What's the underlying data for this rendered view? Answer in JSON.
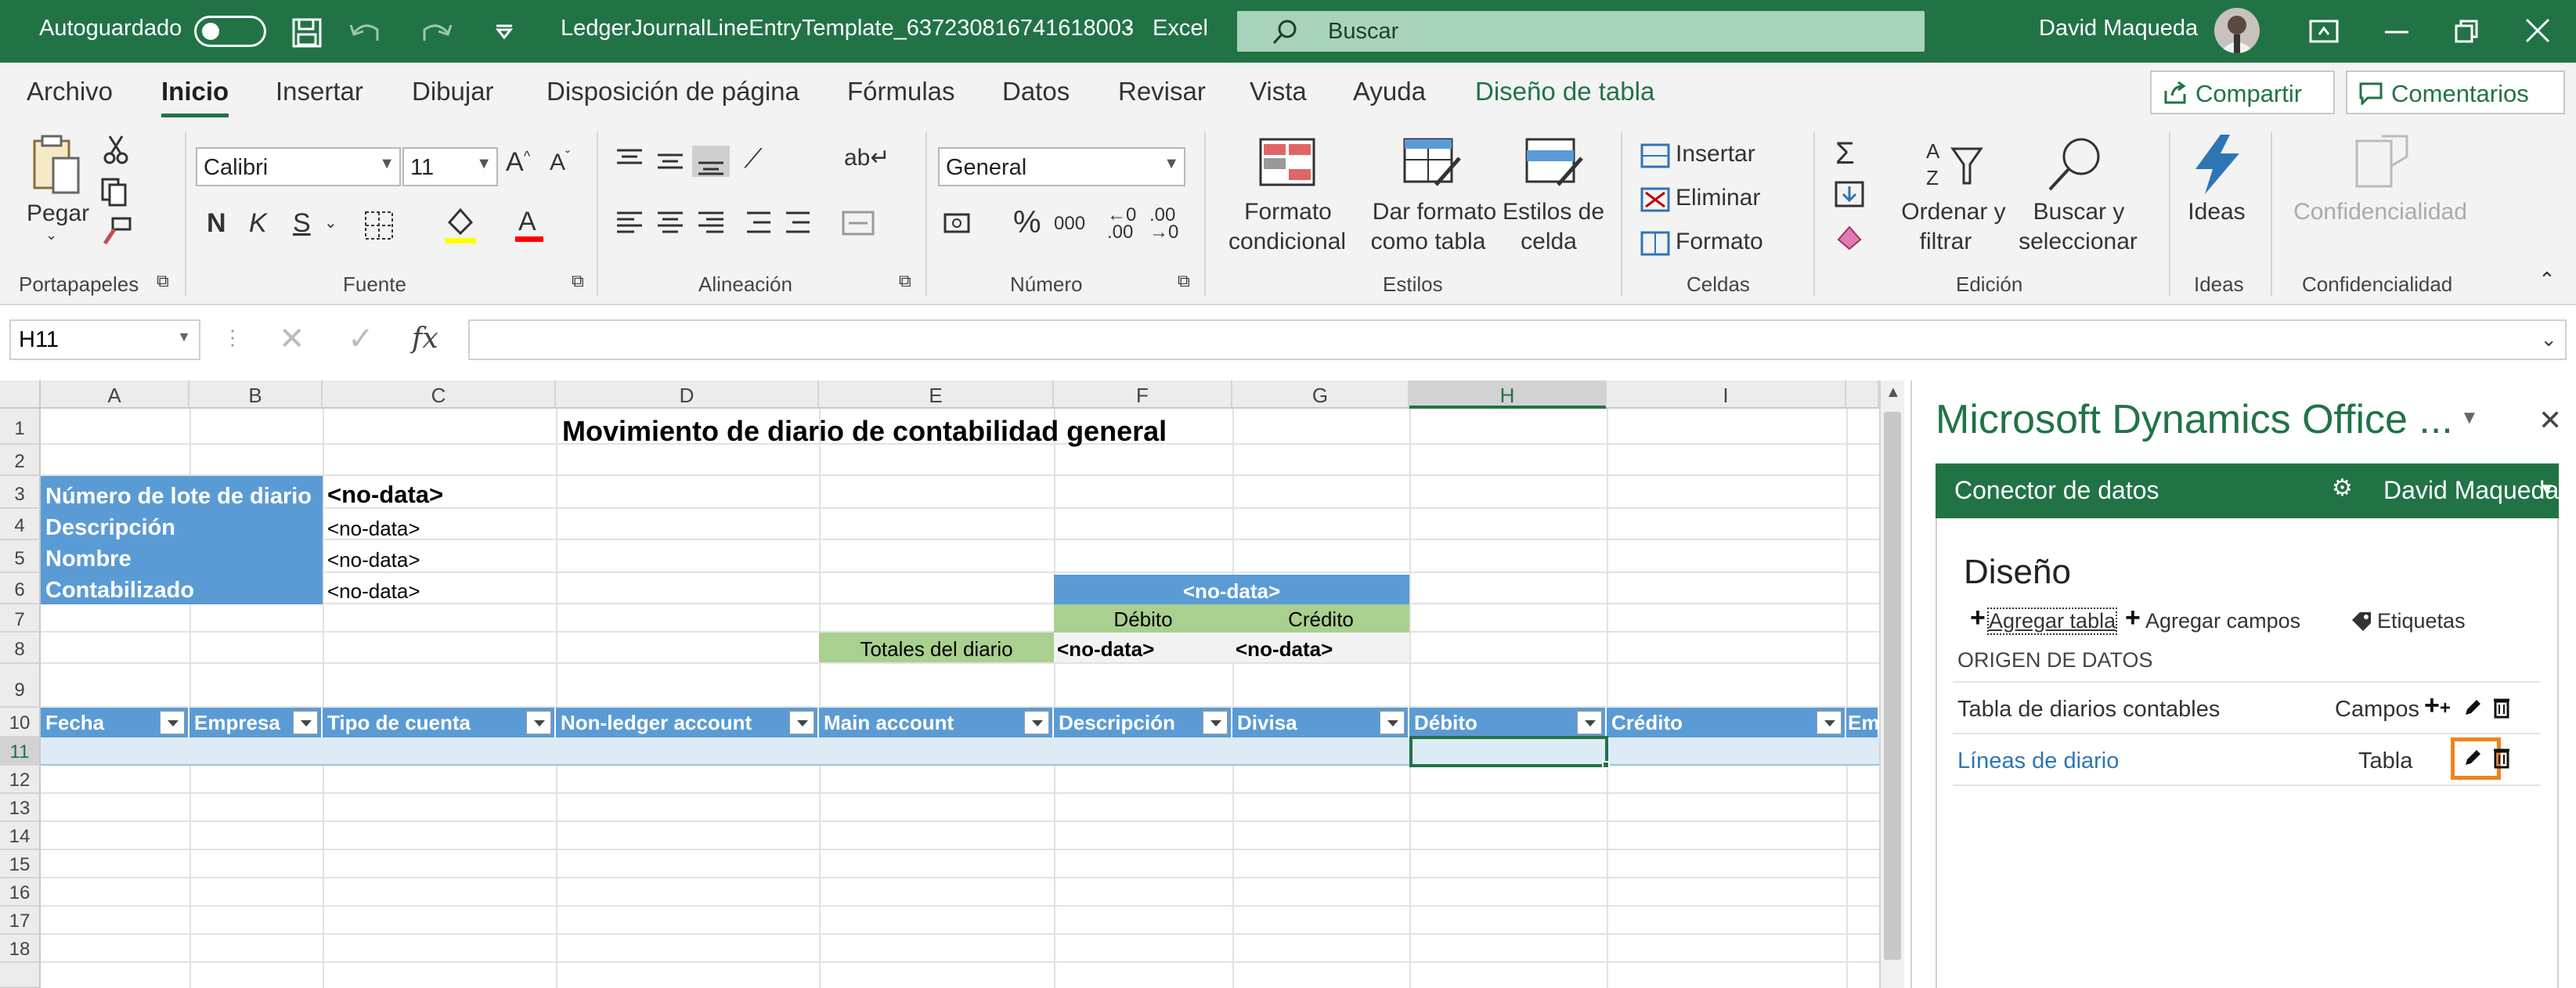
{
  "titlebar": {
    "autosave_label": "Autoguardado",
    "filename": "LedgerJournalLineEntryTemplate_637230816741618003",
    "separator": "-",
    "app_name": "Excel",
    "search_placeholder": "Buscar",
    "user_name": "David Maqueda"
  },
  "tabs": [
    "Archivo",
    "Inicio",
    "Insertar",
    "Dibujar",
    "Disposición de página",
    "Fórmulas",
    "Datos",
    "Revisar",
    "Vista",
    "Ayuda",
    "Diseño de tabla"
  ],
  "share_label": "Compartir",
  "comments_label": "Comentarios",
  "ribbon": {
    "clipboard": {
      "paste": "Pegar",
      "group": "Portapapeles"
    },
    "font": {
      "name": "Calibri",
      "size": "11",
      "bold": "N",
      "italic": "K",
      "underline": "S",
      "group": "Fuente"
    },
    "alignment": {
      "group": "Alineación"
    },
    "number": {
      "format": "General",
      "percent": "%",
      "thousands": "000",
      "group": "Número"
    },
    "styles": {
      "conditional_1": "Formato",
      "conditional_2": "condicional",
      "as_table_1": "Dar formato",
      "as_table_2": "como tabla",
      "cell_styles_1": "Estilos de",
      "cell_styles_2": "celda",
      "group": "Estilos"
    },
    "cells": {
      "insert": "Insertar",
      "delete": "Eliminar",
      "format": "Formato",
      "group": "Celdas"
    },
    "editing": {
      "sort_1": "Ordenar y",
      "sort_2": "filtrar",
      "find_1": "Buscar y",
      "find_2": "seleccionar",
      "group": "Edición"
    },
    "ideas": {
      "label": "Ideas",
      "group": "Ideas"
    },
    "sensitivity": {
      "label": "Confidencialidad",
      "group": "Confidencialidad"
    }
  },
  "formula_bar": {
    "name_box": "H11",
    "formula": ""
  },
  "sheet": {
    "columns": [
      "A",
      "B",
      "C",
      "D",
      "E",
      "F",
      "G",
      "H",
      "I"
    ],
    "rows": [
      "1",
      "2",
      "3",
      "4",
      "5",
      "6",
      "7",
      "8",
      "9",
      "10",
      "11",
      "12",
      "13",
      "14",
      "15",
      "16",
      "17",
      "18"
    ],
    "title": "Movimiento de diario de contabilidad general",
    "labels": {
      "batch": "Número de lote de diario",
      "description": "Descripción",
      "name": "Nombre",
      "posted": "Contabilizado"
    },
    "values": {
      "batch": "<no-data>",
      "description": "<no-data>",
      "name": "<no-data>",
      "posted": "<no-data>"
    },
    "totals": {
      "header": "<no-data>",
      "debit_label": "Débito",
      "credit_label": "Crédito",
      "row_label": "Totales del diario",
      "debit_value": "<no-data>",
      "credit_value": "<no-data>"
    },
    "table_headers": [
      "Fecha",
      "Empresa",
      "Tipo de cuenta",
      "Non-ledger account",
      "Main account",
      "Descripción",
      "Divisa",
      "Débito",
      "Crédito",
      "Em"
    ]
  },
  "addin": {
    "title": "Microsoft Dynamics Office ...",
    "connector": "Conector de datos",
    "user": "David Maqueda",
    "section": "Diseño",
    "actions": {
      "add_table": "Agregar tabla",
      "add_fields": "Agregar campos",
      "labels": "Etiquetas"
    },
    "data_source_header": "ORIGEN DE DATOS",
    "sources": [
      {
        "name": "Tabla de diarios contables",
        "kind": "Campos"
      },
      {
        "name": "Líneas de diario",
        "kind": "Tabla"
      }
    ]
  },
  "colors": {
    "excel_green": "#217346",
    "table_header": "#5b9bd5",
    "label_fill": "#a9d08e",
    "highlight": "#f0821e"
  }
}
